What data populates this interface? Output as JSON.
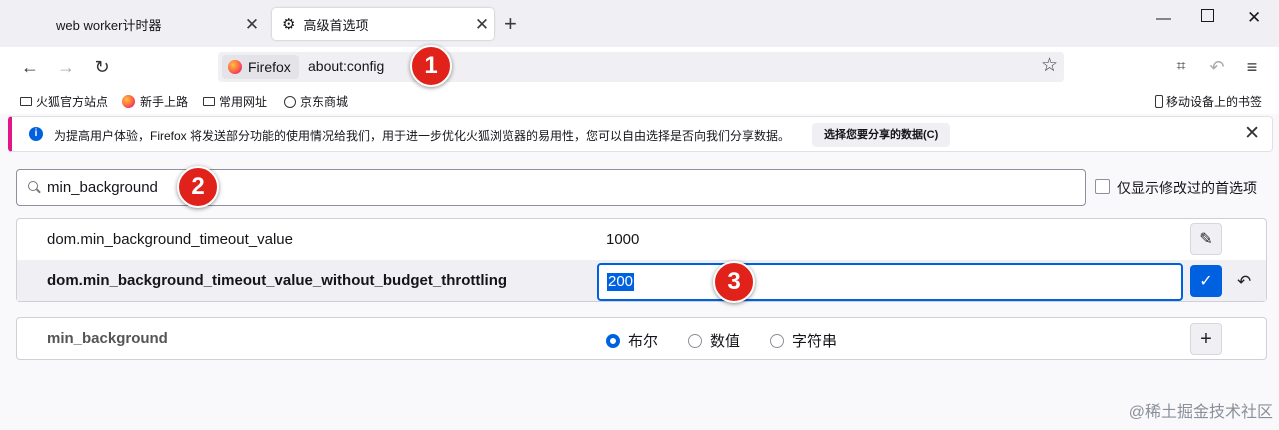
{
  "tabs": [
    {
      "title": "web worker计时器",
      "active": false
    },
    {
      "title": "高级首选项",
      "active": true
    }
  ],
  "url": {
    "identity_label": "Firefox",
    "text": "about:config"
  },
  "bookmarks": [
    {
      "label": "火狐官方站点",
      "icon": "folder-icon"
    },
    {
      "label": "新手上路",
      "icon": "firefox-icon"
    },
    {
      "label": "常用网址",
      "icon": "folder-icon"
    },
    {
      "label": "京东商城",
      "icon": "globe-icon"
    }
  ],
  "mobile_bookmarks": "移动设备上的书签",
  "notification": {
    "text": "为提高用户体验，Firefox 将发送部分功能的使用情况给我们，用于进一步优化火狐浏览器的易用性，您可以自由选择是否向我们分享数据。",
    "button": "选择您要分享的数据(C)"
  },
  "search": {
    "value": "min_background"
  },
  "show_modified_only_label": "仅显示修改过的首选项",
  "prefs": [
    {
      "name": "dom.min_background_timeout_value",
      "value": "1000"
    },
    {
      "name": "dom.min_background_timeout_value_without_budget_throttling",
      "value": "200"
    }
  ],
  "new_pref": {
    "name": "min_background",
    "types": [
      "布尔",
      "数值",
      "字符串"
    ],
    "selected": "布尔"
  },
  "badges": [
    "1",
    "2",
    "3"
  ],
  "watermark": "@稀土掘金技术社区",
  "colors": {
    "accent": "#0061e0",
    "badge": "#e0221b",
    "notification_stripe": "#e31587"
  }
}
